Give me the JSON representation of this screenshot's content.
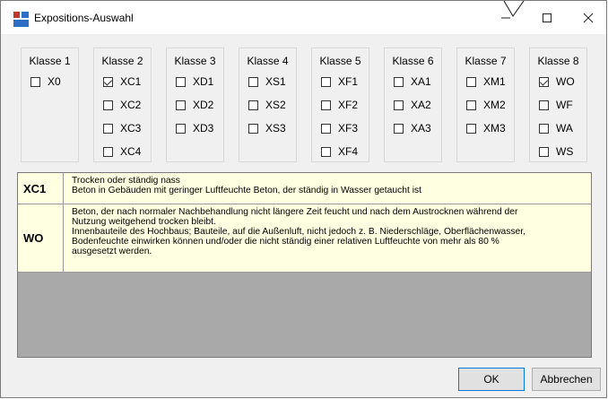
{
  "window": {
    "title": "Expositions-Auswahl"
  },
  "classes": [
    {
      "label": "Klasse 1",
      "items": [
        {
          "code": "X0",
          "checked": false
        }
      ]
    },
    {
      "label": "Klasse 2",
      "items": [
        {
          "code": "XC1",
          "checked": true
        },
        {
          "code": "XC2",
          "checked": false
        },
        {
          "code": "XC3",
          "checked": false
        },
        {
          "code": "XC4",
          "checked": false
        }
      ]
    },
    {
      "label": "Klasse 3",
      "items": [
        {
          "code": "XD1",
          "checked": false
        },
        {
          "code": "XD2",
          "checked": false
        },
        {
          "code": "XD3",
          "checked": false
        }
      ]
    },
    {
      "label": "Klasse 4",
      "items": [
        {
          "code": "XS1",
          "checked": false
        },
        {
          "code": "XS2",
          "checked": false
        },
        {
          "code": "XS3",
          "checked": false
        }
      ]
    },
    {
      "label": "Klasse 5",
      "items": [
        {
          "code": "XF1",
          "checked": false
        },
        {
          "code": "XF2",
          "checked": false
        },
        {
          "code": "XF3",
          "checked": false
        },
        {
          "code": "XF4",
          "checked": false
        }
      ]
    },
    {
      "label": "Klasse 6",
      "items": [
        {
          "code": "XA1",
          "checked": false
        },
        {
          "code": "XA2",
          "checked": false
        },
        {
          "code": "XA3",
          "checked": false
        }
      ]
    },
    {
      "label": "Klasse 7",
      "items": [
        {
          "code": "XM1",
          "checked": false
        },
        {
          "code": "XM2",
          "checked": false
        },
        {
          "code": "XM3",
          "checked": false
        }
      ]
    },
    {
      "label": "Klasse 8",
      "items": [
        {
          "code": "WO",
          "checked": true
        },
        {
          "code": "WF",
          "checked": false
        },
        {
          "code": "WA",
          "checked": false
        },
        {
          "code": "WS",
          "checked": false
        }
      ]
    }
  ],
  "descriptions": [
    {
      "code": "XC1",
      "text": "Trocken oder ständig nass\nBeton in Gebäuden mit geringer Luftfeuchte Beton, der ständig in Wasser getaucht ist"
    },
    {
      "code": "WO",
      "text": "Beton, der nach normaler Nachbehandlung nicht längere Zeit feucht und nach dem Austrocknen während der\nNutzung weitgehend trocken bleibt.\nInnenbauteile des Hochbaus; Bauteile, auf die Außenluft, nicht jedoch z. B. Niederschläge, Oberflächenwasser,\nBodenfeuchte einwirken können und/oder die nicht ständig einer relativen Luftfeuchte von mehr als 80 %\nausgesetzt werden."
    }
  ],
  "buttons": {
    "ok": "OK",
    "cancel": "Abbrechen"
  },
  "icons": {
    "app": "app-icon",
    "minimize": "minimize-icon",
    "maximize": "maximize-icon",
    "close": "close-icon"
  },
  "colors": {
    "title_bg": "#ffffff",
    "window_bg": "#f0f0f0",
    "desc_bg": "#ffffe1",
    "panel_bg": "#a9a9a9",
    "accent": "#0078d7"
  }
}
